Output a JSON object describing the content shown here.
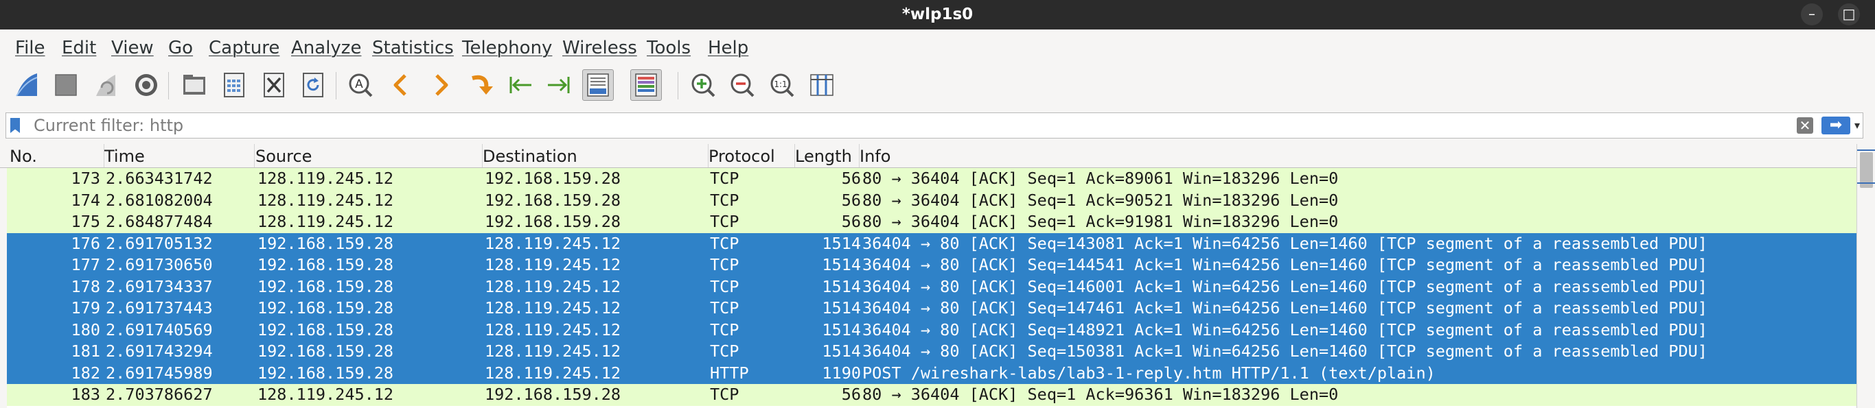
{
  "window": {
    "title": "*wlp1s0",
    "minimize_glyph": "–",
    "maximize_glyph": "□"
  },
  "menu": [
    "File",
    "Edit",
    "View",
    "Go",
    "Capture",
    "Analyze",
    "Statistics",
    "Telephony",
    "Wireless",
    "Tools",
    "Help"
  ],
  "toolbar": {
    "icons": [
      "start-capture-icon",
      "stop-capture-icon",
      "restart-capture-icon",
      "capture-options-icon",
      "open-file-icon",
      "save-file-icon",
      "close-file-icon",
      "reload-file-icon",
      "find-packet-icon",
      "go-back-icon",
      "go-forward-icon",
      "go-to-packet-icon",
      "first-packet-icon",
      "last-packet-icon",
      "auto-scroll-icon",
      "colorize-icon",
      "zoom-in-icon",
      "zoom-out-icon",
      "normal-size-icon",
      "resize-columns-icon"
    ]
  },
  "filter": {
    "placeholder": "Current filter: http",
    "clear_glyph": "✕",
    "apply_glyph": "➡",
    "dropdown_glyph": "▾"
  },
  "columns": [
    "No.",
    "Time",
    "Source",
    "Destination",
    "Protocol",
    "Length",
    "Info"
  ],
  "colors": {
    "tcp_row": "#e7fdcc",
    "selected_row": "#2f82c8",
    "http_row": "#e4fcd0"
  },
  "packets": [
    {
      "no": "173",
      "time": "2.663431742",
      "source": "128.119.245.12",
      "destination": "192.168.159.28",
      "protocol": "TCP",
      "length": "56",
      "info": "80 → 36404 [ACK] Seq=1 Ack=89061 Win=183296 Len=0",
      "selected": false
    },
    {
      "no": "174",
      "time": "2.681082004",
      "source": "128.119.245.12",
      "destination": "192.168.159.28",
      "protocol": "TCP",
      "length": "56",
      "info": "80 → 36404 [ACK] Seq=1 Ack=90521 Win=183296 Len=0",
      "selected": false
    },
    {
      "no": "175",
      "time": "2.684877484",
      "source": "128.119.245.12",
      "destination": "192.168.159.28",
      "protocol": "TCP",
      "length": "56",
      "info": "80 → 36404 [ACK] Seq=1 Ack=91981 Win=183296 Len=0",
      "selected": false
    },
    {
      "no": "176",
      "time": "2.691705132",
      "source": "192.168.159.28",
      "destination": "128.119.245.12",
      "protocol": "TCP",
      "length": "1514",
      "info": "36404 → 80 [ACK] Seq=143081 Ack=1 Win=64256 Len=1460 [TCP segment of a reassembled PDU]",
      "selected": true
    },
    {
      "no": "177",
      "time": "2.691730650",
      "source": "192.168.159.28",
      "destination": "128.119.245.12",
      "protocol": "TCP",
      "length": "1514",
      "info": "36404 → 80 [ACK] Seq=144541 Ack=1 Win=64256 Len=1460 [TCP segment of a reassembled PDU]",
      "selected": true
    },
    {
      "no": "178",
      "time": "2.691734337",
      "source": "192.168.159.28",
      "destination": "128.119.245.12",
      "protocol": "TCP",
      "length": "1514",
      "info": "36404 → 80 [ACK] Seq=146001 Ack=1 Win=64256 Len=1460 [TCP segment of a reassembled PDU]",
      "selected": true
    },
    {
      "no": "179",
      "time": "2.691737443",
      "source": "192.168.159.28",
      "destination": "128.119.245.12",
      "protocol": "TCP",
      "length": "1514",
      "info": "36404 → 80 [ACK] Seq=147461 Ack=1 Win=64256 Len=1460 [TCP segment of a reassembled PDU]",
      "selected": true
    },
    {
      "no": "180",
      "time": "2.691740569",
      "source": "192.168.159.28",
      "destination": "128.119.245.12",
      "protocol": "TCP",
      "length": "1514",
      "info": "36404 → 80 [ACK] Seq=148921 Ack=1 Win=64256 Len=1460 [TCP segment of a reassembled PDU]",
      "selected": true
    },
    {
      "no": "181",
      "time": "2.691743294",
      "source": "192.168.159.28",
      "destination": "128.119.245.12",
      "protocol": "TCP",
      "length": "1514",
      "info": "36404 → 80 [ACK] Seq=150381 Ack=1 Win=64256 Len=1460 [TCP segment of a reassembled PDU]",
      "selected": true
    },
    {
      "no": "182",
      "time": "2.691745989",
      "source": "192.168.159.28",
      "destination": "128.119.245.12",
      "protocol": "HTTP",
      "length": "1190",
      "info": "POST /wireshark-labs/lab3-1-reply.htm HTTP/1.1  (text/plain)",
      "selected": true
    },
    {
      "no": "183",
      "time": "2.703786627",
      "source": "128.119.245.12",
      "destination": "192.168.159.28",
      "protocol": "TCP",
      "length": "56",
      "info": "80 → 36404 [ACK] Seq=1 Ack=96361 Win=183296 Len=0",
      "selected": false
    }
  ]
}
